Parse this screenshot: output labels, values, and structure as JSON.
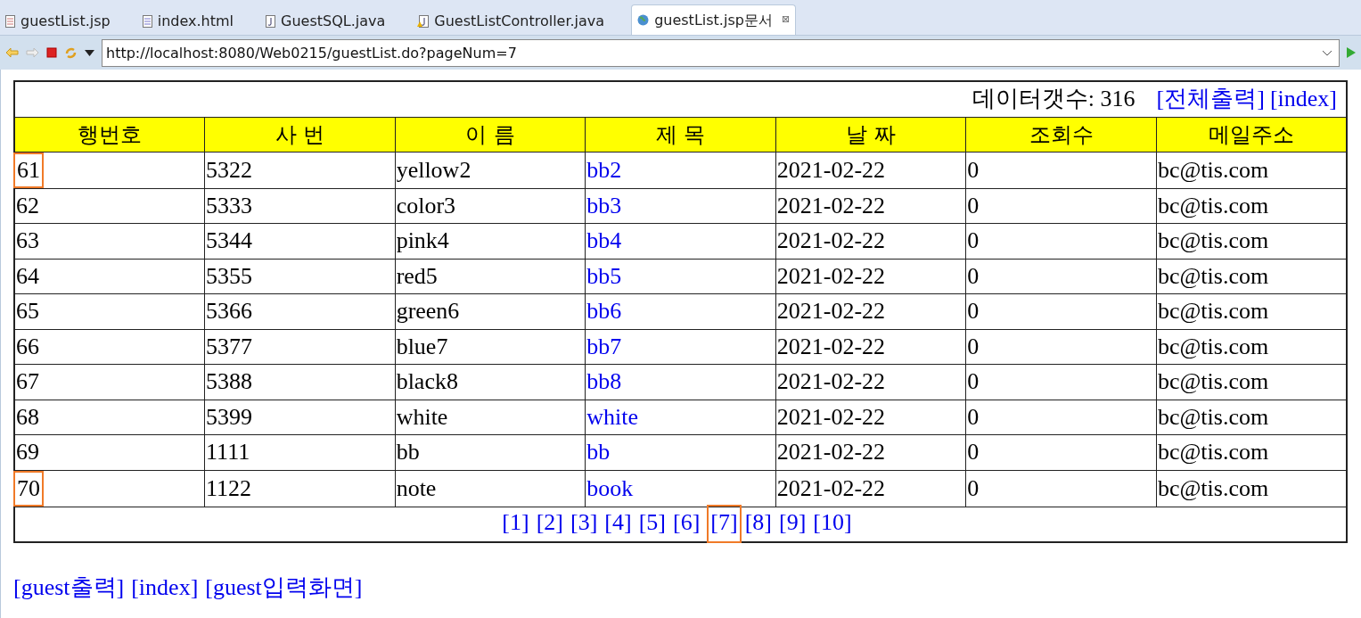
{
  "tabs": [
    {
      "label": "guestList.jsp",
      "kind": "jsp",
      "selected": false
    },
    {
      "label": "index.html",
      "kind": "html",
      "selected": false
    },
    {
      "label": "GuestSQL.java",
      "kind": "java",
      "selected": false
    },
    {
      "label": "GuestListController.java",
      "kind": "javawarn",
      "selected": false
    },
    {
      "label": "guestList.jsp문서",
      "kind": "web",
      "selected": true,
      "close": "⊠"
    }
  ],
  "address": {
    "value": "http://localhost:8080/Web0215/guestList.do?pageNum=7"
  },
  "summary": {
    "text": "데이터갯수: 316",
    "links": [
      "[전체출력]",
      "[index]"
    ]
  },
  "table": {
    "columns": [
      "행번호",
      "사 번",
      "이 름",
      "제 목",
      "날 짜",
      "조회수",
      "메일주소"
    ],
    "rows": [
      {
        "cells": [
          "61",
          "5322",
          "yellow2",
          "bb2",
          "2021-02-22",
          "0",
          "bc@tis.com"
        ],
        "highlighted": true
      },
      {
        "cells": [
          "62",
          "5333",
          "color3",
          "bb3",
          "2021-02-22",
          "0",
          "bc@tis.com"
        ],
        "highlighted": false
      },
      {
        "cells": [
          "63",
          "5344",
          "pink4",
          "bb4",
          "2021-02-22",
          "0",
          "bc@tis.com"
        ],
        "highlighted": false
      },
      {
        "cells": [
          "64",
          "5355",
          "red5",
          "bb5",
          "2021-02-22",
          "0",
          "bc@tis.com"
        ],
        "highlighted": false
      },
      {
        "cells": [
          "65",
          "5366",
          "green6",
          "bb6",
          "2021-02-22",
          "0",
          "bc@tis.com"
        ],
        "highlighted": false
      },
      {
        "cells": [
          "66",
          "5377",
          "blue7",
          "bb7",
          "2021-02-22",
          "0",
          "bc@tis.com"
        ],
        "highlighted": false
      },
      {
        "cells": [
          "67",
          "5388",
          "black8",
          "bb8",
          "2021-02-22",
          "0",
          "bc@tis.com"
        ],
        "highlighted": false
      },
      {
        "cells": [
          "68",
          "5399",
          "white",
          "white",
          "2021-02-22",
          "0",
          "bc@tis.com"
        ],
        "highlighted": false
      },
      {
        "cells": [
          "69",
          "1111",
          "bb",
          "bb",
          "2021-02-22",
          "0",
          "bc@tis.com"
        ],
        "highlighted": false
      },
      {
        "cells": [
          "70",
          "1122",
          "note",
          "book",
          "2021-02-22",
          "0",
          "bc@tis.com"
        ],
        "highlighted": true
      }
    ],
    "pages": [
      {
        "label": "[1]",
        "highlighted": false
      },
      {
        "label": "[2]",
        "highlighted": false
      },
      {
        "label": "[3]",
        "highlighted": false
      },
      {
        "label": "[4]",
        "highlighted": false
      },
      {
        "label": "[5]",
        "highlighted": false
      },
      {
        "label": "[6]",
        "highlighted": false
      },
      {
        "label": "[7]",
        "highlighted": true
      },
      {
        "label": "[8]",
        "highlighted": false
      },
      {
        "label": "[9]",
        "highlighted": false
      },
      {
        "label": "[10]",
        "highlighted": false
      }
    ]
  },
  "footer_links": [
    "[guest출력]",
    "[index]",
    "[guest입력화면]"
  ]
}
